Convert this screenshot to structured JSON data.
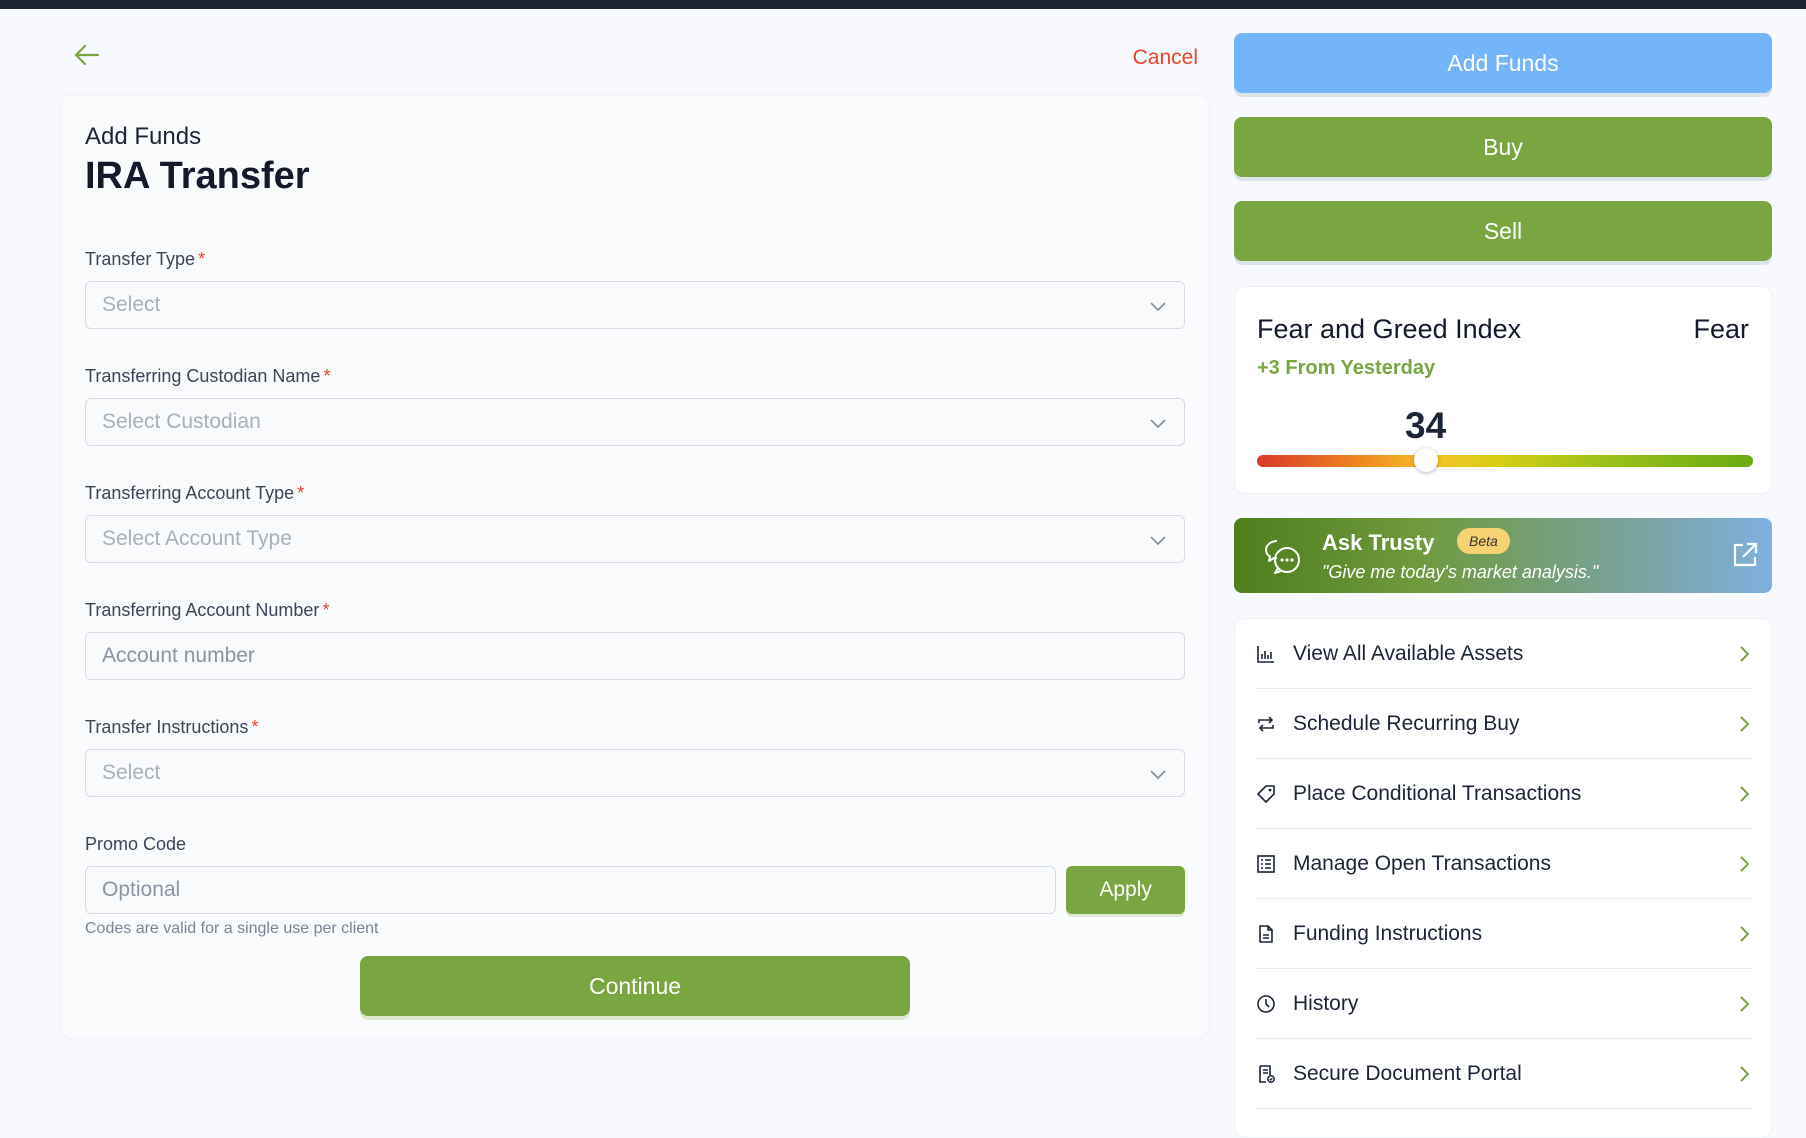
{
  "header": {
    "cancel_label": "Cancel"
  },
  "form": {
    "eyebrow": "Add Funds",
    "title": "IRA Transfer",
    "required_mark": "*",
    "fields": [
      {
        "label": "Transfer Type",
        "required": true,
        "kind": "select",
        "placeholder": "Select"
      },
      {
        "label": "Transferring Custodian Name",
        "required": true,
        "kind": "select",
        "placeholder": "Select Custodian"
      },
      {
        "label": "Transferring Account Type",
        "required": true,
        "kind": "select",
        "placeholder": "Select Account Type"
      },
      {
        "label": "Transferring Account Number",
        "required": true,
        "kind": "text",
        "placeholder": "Account number",
        "value": ""
      },
      {
        "label": "Transfer Instructions",
        "required": true,
        "kind": "select",
        "placeholder": "Select"
      }
    ],
    "promo": {
      "label": "Promo Code",
      "placeholder": "Optional",
      "value": "",
      "apply_label": "Apply",
      "helper": "Codes are valid for a single use per client"
    },
    "continue_label": "Continue"
  },
  "actions": {
    "add_funds": "Add Funds",
    "buy": "Buy",
    "sell": "Sell"
  },
  "fear_greed": {
    "title": "Fear and Greed Index",
    "status": "Fear",
    "change": "+3 From Yesterday",
    "value": "34",
    "level": 34
  },
  "trusty": {
    "name": "Ask Trusty",
    "badge": "Beta",
    "prompt": "\"Give me today's market analysis.\""
  },
  "menu": [
    {
      "label": "View All Available Assets",
      "icon": "bar-chart-icon"
    },
    {
      "label": "Schedule Recurring Buy",
      "icon": "repeat-icon"
    },
    {
      "label": "Place Conditional Transactions",
      "icon": "tag-icon"
    },
    {
      "label": "Manage Open Transactions",
      "icon": "list-icon"
    },
    {
      "label": "Funding Instructions",
      "icon": "document-icon"
    },
    {
      "label": "History",
      "icon": "clock-icon"
    },
    {
      "label": "Secure Document Portal",
      "icon": "secure-document-icon"
    }
  ],
  "colors": {
    "accent_green": "#7aa641",
    "accent_blue": "#74b4f8",
    "danger": "#e4442a"
  }
}
